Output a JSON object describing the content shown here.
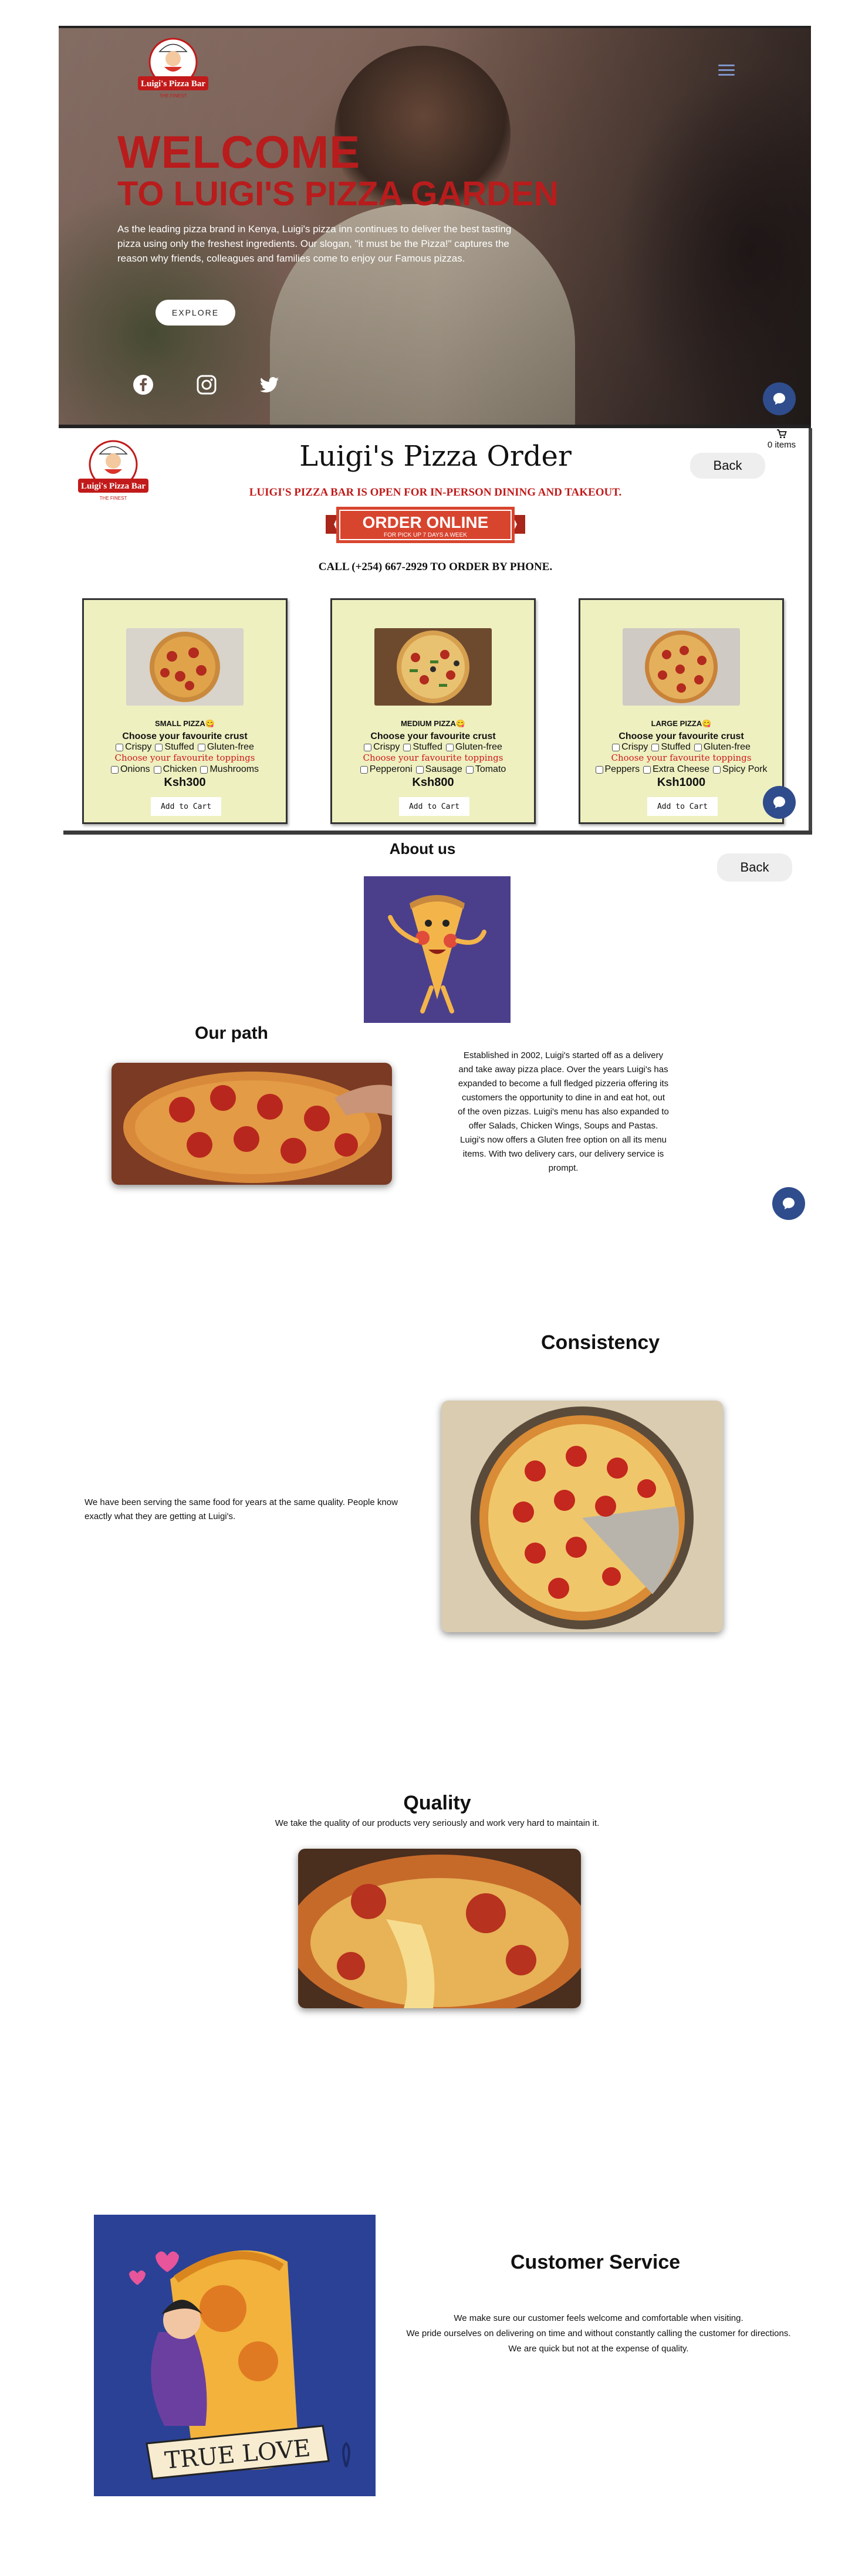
{
  "brand": {
    "logo_text": "Luigi's Pizza Bar",
    "logo_tagline": "THE FINEST",
    "colors": {
      "accent_red": "#b81c1c",
      "card_bg": "#eef0c0",
      "chat_blue": "#2f4d8c",
      "mascot_bg": "#4b3f8c"
    }
  },
  "hero": {
    "title_line1": "WELCOME",
    "title_line2": "TO LUIGI'S PIZZA GARDEN",
    "description": "As the leading pizza brand in Kenya, Luigi's pizza inn continues to deliver the best tasting pizza using only the freshest ingredients. Our slogan, \"it must be the Pizza!\" captures the reason why friends, colleagues and families come to enjoy our Famous pizzas.",
    "explore_label": "EXPLORE",
    "menu_icon": "hamburger-menu-icon",
    "social_icons": [
      "facebook-icon",
      "instagram-icon",
      "twitter-icon"
    ],
    "chat_icon": "chat-icon"
  },
  "order": {
    "title": "Luigi's Pizza Order",
    "open_notice": "LUIGI'S PIZZA BAR IS OPEN FOR IN-PERSON DINING AND TAKEOUT.",
    "banner_main": "ORDER ONLINE",
    "banner_sub": "FOR PICK UP 7 DAYS A WEEK",
    "call_text": "CALL (+254) 667-2929 TO ORDER BY PHONE.",
    "cart_count": "0 items",
    "cart_icon": "cart-icon",
    "back_label": "Back",
    "crust_heading": "Choose your favourite crust",
    "toppings_heading": "Choose your favourite toppings",
    "add_to_cart_label": "Add to Cart",
    "products": [
      {
        "size": "SMALL PIZZA😋",
        "crusts": [
          "Crispy",
          "Stuffed",
          "Gluten-free"
        ],
        "toppings": [
          "Onions",
          "Chicken",
          "Mushrooms"
        ],
        "price": "Ksh300"
      },
      {
        "size": "MEDIUM PIZZA😋",
        "crusts": [
          "Crispy",
          "Stuffed",
          "Gluten-free"
        ],
        "toppings": [
          "Pepperoni",
          "Sausage",
          "Tomato"
        ],
        "price": "Ksh800"
      },
      {
        "size": "LARGE PIZZA😋",
        "crusts": [
          "Crispy",
          "Stuffed",
          "Gluten-free"
        ],
        "toppings": [
          "Peppers",
          "Extra Cheese",
          "Spicy Pork"
        ],
        "price": "Ksh1000"
      }
    ]
  },
  "about": {
    "title": "About us",
    "back_label": "Back",
    "path_heading": "Our path",
    "path_text": "Established in 2002, Luigi's started off as a delivery and take away pizza place. Over the years Luigi's has expanded to become a full fledged pizzeria offering its customers the opportunity to dine in and eat hot, out of the oven pizzas. Luigi's menu has also expanded to offer Salads, Chicken Wings, Soups and Pastas. Luigi's now offers a Gluten free option on all its menu items. With two delivery cars, our delivery service is prompt.",
    "consistency_heading": "Consistency",
    "consistency_text": "We have been serving the same food for years at the same quality. People know exactly what they are getting at Luigi's.",
    "quality_heading": "Quality",
    "quality_text": "We take the quality of our products very seriously and work very hard to maintain it.",
    "service_heading": "Customer Service",
    "service_lines": [
      "We make sure our customer feels welcome and comfortable when visiting.",
      "We pride ourselves on delivering on time and without constantly calling the customer for directions.",
      "We are quick but not at the expense of quality."
    ],
    "true_love_text": "TRUE LOVE"
  }
}
